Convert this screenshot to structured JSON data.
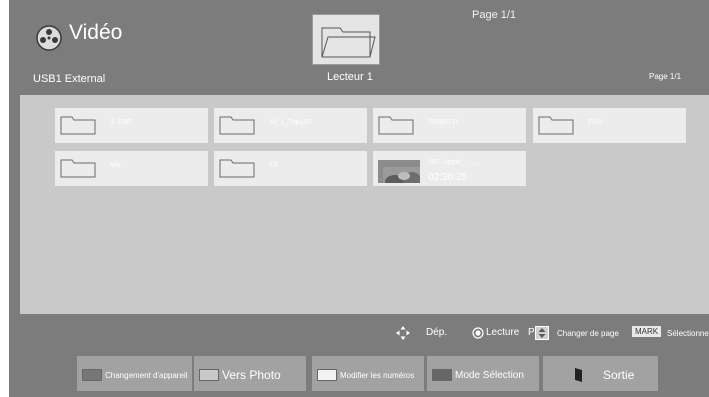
{
  "header": {
    "title": "Vidéo",
    "page_top": "Page 1/1",
    "device": "USB1 External",
    "reader": "Lecteur 1",
    "page_right": "Page 1/1",
    "icon": "film-reel-icon",
    "folder_icon": "folder-icon"
  },
  "items": [
    {
      "name": "1. EMF",
      "type": "folder"
    },
    {
      "name": "10_1_Top100",
      "type": "folder"
    },
    {
      "name": "20090711",
      "type": "folder"
    },
    {
      "name": "FHD",
      "type": "folder"
    },
    {
      "name": "MV",
      "type": "folder"
    },
    {
      "name": "TS",
      "type": "folder"
    },
    {
      "name": "051. Apple_ ......",
      "duration": "02:30:25",
      "type": "video"
    }
  ],
  "legend": {
    "move": "Dép.",
    "play": "Lecture",
    "page_key": "P",
    "change_page": "Changer de page",
    "mark_key": "MARK",
    "select": "Sélectionner"
  },
  "buttons": [
    {
      "label": "Changement d'appareil",
      "swatch": "#777777"
    },
    {
      "label": "Vers Photo",
      "swatch": "#c9c9c9"
    },
    {
      "label": "Modifier les numéros",
      "swatch": "#f2f2f2"
    },
    {
      "label": "Mode Sélection",
      "swatch": "#666666"
    },
    {
      "label": "Sortie",
      "swatch": "#222222"
    }
  ],
  "colors": {
    "background": "#7c7c7c",
    "panel": "#c9c9c9",
    "tile": "#ececec",
    "button": "#a2a2a2"
  }
}
